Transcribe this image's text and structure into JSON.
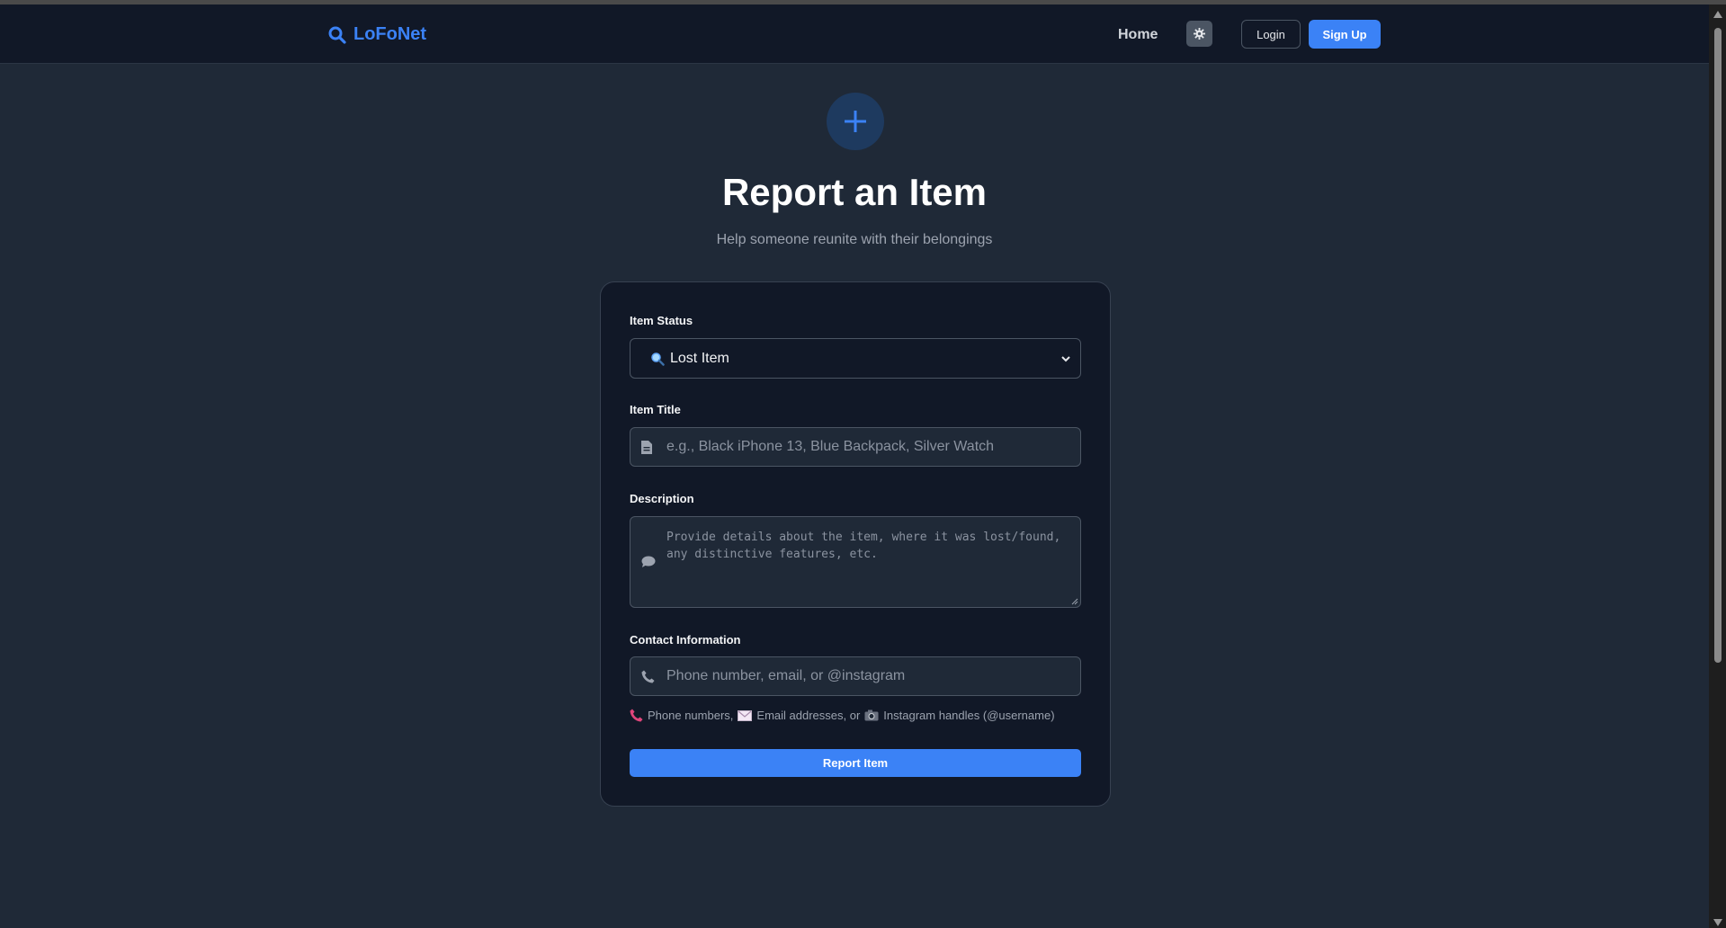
{
  "nav": {
    "brand": "LoFoNet",
    "home": "Home",
    "login": "Login",
    "signup": "Sign Up"
  },
  "hero": {
    "title": "Report an Item",
    "subtitle": "Help someone reunite with their belongings"
  },
  "form": {
    "status_label": "Item Status",
    "status_value": "Lost Item",
    "title_label": "Item Title",
    "title_placeholder": "e.g., Black iPhone 13, Blue Backpack, Silver Watch",
    "description_label": "Description",
    "description_placeholder": "Provide details about the item, where it was lost/found, any distinctive features, etc.",
    "contact_label": "Contact Information",
    "contact_placeholder": "Phone number, email, or @instagram",
    "hint_phone": "Phone numbers,",
    "hint_email": "Email addresses, or",
    "hint_instagram": "Instagram handles (@username)",
    "submit": "Report Item"
  },
  "colors": {
    "accent": "#3b82f6",
    "background": "#1f2937",
    "navbar": "#111827",
    "card": "#111827"
  },
  "icons": [
    "search-icon",
    "gear-icon",
    "plus-icon",
    "magnifier-emoji-icon",
    "document-icon",
    "comment-icon",
    "phone-icon",
    "telephone-emoji-icon",
    "envelope-emoji-icon",
    "camera-emoji-icon",
    "chevron-down-icon"
  ]
}
